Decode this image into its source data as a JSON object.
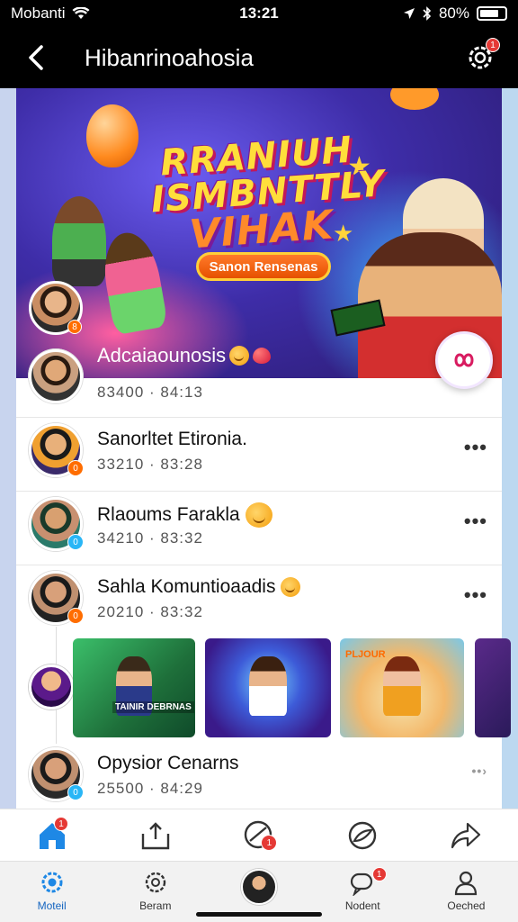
{
  "status_bar": {
    "carrier": "Mobanti",
    "time": "13:21",
    "battery": "80%"
  },
  "header": {
    "title": "Hibanrinoahosia",
    "settings_badge": "1"
  },
  "banner": {
    "title_line1": "RRANIUH",
    "title_line2": "ISMBNTTLY",
    "title_line3": "VIHAK",
    "pill_label": "Sanon Rensenas",
    "avatar_badge": "8"
  },
  "featured": {
    "title": "Adcaiaounosis",
    "meta": "83400 · 84:13"
  },
  "rows": [
    {
      "title": "Sanorltet Etironia.",
      "meta": "33210 · 83:28",
      "badge": "0",
      "badge_color": "#ff6d00"
    },
    {
      "title": "Rlaoums Farakla",
      "meta": "34210 · 83:32",
      "badge": "0",
      "badge_color": "#29b6f6"
    },
    {
      "title": "Sahla Komuntioaadis",
      "meta": "20210 · 83:32",
      "badge": "0",
      "badge_color": "#ff6d00"
    },
    {
      "title": "Opysior Cenarns",
      "meta": "25500 · 84:29",
      "badge": "0",
      "badge_color": "#29b6f6"
    }
  ],
  "media": {
    "thumb1_label": "TAINIR DEBRNAS",
    "thumb3_label": "PLJOUR"
  },
  "nav_top": {
    "home_badge": "1",
    "chat_badge": "1"
  },
  "nav_bottom": {
    "tabs": [
      "Moteil",
      "Beram",
      "",
      "Nodent",
      "Oeched"
    ],
    "notif_badge": "1"
  },
  "colors": {
    "accent": "#1565c0",
    "badge": "#e53935"
  }
}
